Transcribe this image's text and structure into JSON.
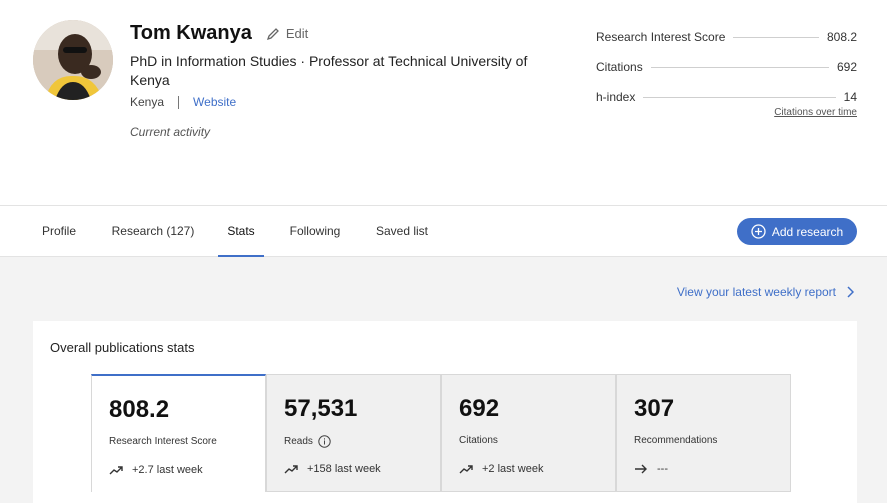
{
  "profile": {
    "name": "Tom Kwanya",
    "edit_label": "Edit",
    "degree": "PhD in Information Studies · Professor at Technical University of Kenya",
    "location": "Kenya",
    "website_label": "Website",
    "activity": "Current activity"
  },
  "metrics": {
    "rows": [
      {
        "label": "Research Interest Score",
        "value": "808.2"
      },
      {
        "label": "Citations",
        "value": "692"
      },
      {
        "label": "h-index",
        "value": "14"
      }
    ],
    "citations_link": "Citations over time"
  },
  "tabs": [
    {
      "label": "Profile"
    },
    {
      "label": "Research (127)"
    },
    {
      "label": "Stats"
    },
    {
      "label": "Following"
    },
    {
      "label": "Saved list"
    }
  ],
  "active_tab": "Stats",
  "add_research_label": "Add research",
  "report_link": "View your latest weekly report",
  "stats": {
    "title": "Overall publications stats",
    "cards": [
      {
        "value": "808.2",
        "label": "Research Interest Score",
        "trend": "+2.7 last week",
        "trend_icon": "trend-up-icon"
      },
      {
        "value": "57,531",
        "label": "Reads",
        "trend": "+158 last week",
        "trend_icon": "trend-up-icon"
      },
      {
        "value": "692",
        "label": "Citations",
        "trend": "+2 last week",
        "trend_icon": "trend-up-icon"
      },
      {
        "value": "307",
        "label": "Recommendations",
        "trend": "---",
        "trend_icon": "arrow-right-icon"
      }
    ]
  },
  "colors": {
    "accent": "#3f6fc8",
    "background_gray": "#f3f3f3"
  }
}
